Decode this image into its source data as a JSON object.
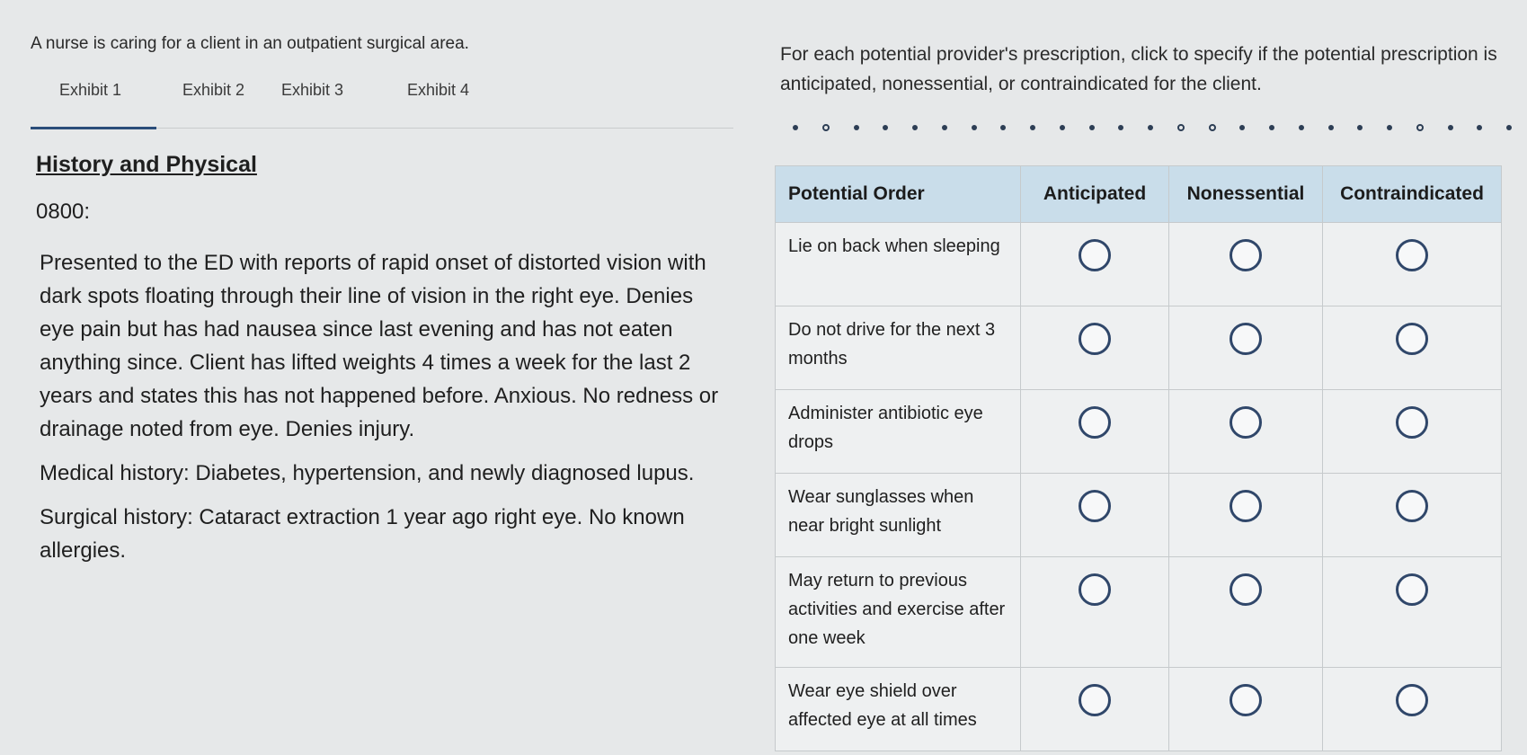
{
  "intro": "A nurse is caring for a client in an outpatient surgical area.",
  "tabs": [
    {
      "label": "Exhibit 1"
    },
    {
      "label": "Exhibit 2"
    },
    {
      "label": "Exhibit 3"
    },
    {
      "label": "Exhibit 4"
    }
  ],
  "exhibit": {
    "title": "History and Physical",
    "time": "0800:",
    "presentation": "Presented to the ED with reports of rapid onset of distorted vision with dark spots floating through their line of vision in the right eye. Denies eye pain but has had nausea since last evening and has not eaten anything since. Client has lifted weights 4 times a week for the last 2 years and states this has not happened before. Anxious. No redness or drainage noted from eye. Denies injury.",
    "medical_history": "Medical history: Diabetes, hypertension, and newly diagnosed lupus.",
    "surgical_history": "Surgical history: Cataract extraction 1 year ago right eye. No known allergies."
  },
  "instructions": "For each potential provider's prescription, click to specify if the potential prescription is anticipated, nonessential, or contraindicated for the client.",
  "table": {
    "headers": [
      "Potential Order",
      "Anticipated",
      "Nonessential",
      "Contraindicated"
    ],
    "rows": [
      {
        "order": "Lie on back when sleeping"
      },
      {
        "order": "Do not drive for the next 3 months"
      },
      {
        "order": "Administer antibiotic eye drops"
      },
      {
        "order": "Wear sunglasses when near bright sunlight"
      },
      {
        "order": "May return to previous activities and exercise after one week"
      },
      {
        "order": "Wear eye shield over affected eye at all times"
      }
    ]
  },
  "colors": {
    "header_bg": "#c9ddea",
    "radio_border": "#30476a",
    "active_tab_underline": "#2a4d7a"
  }
}
